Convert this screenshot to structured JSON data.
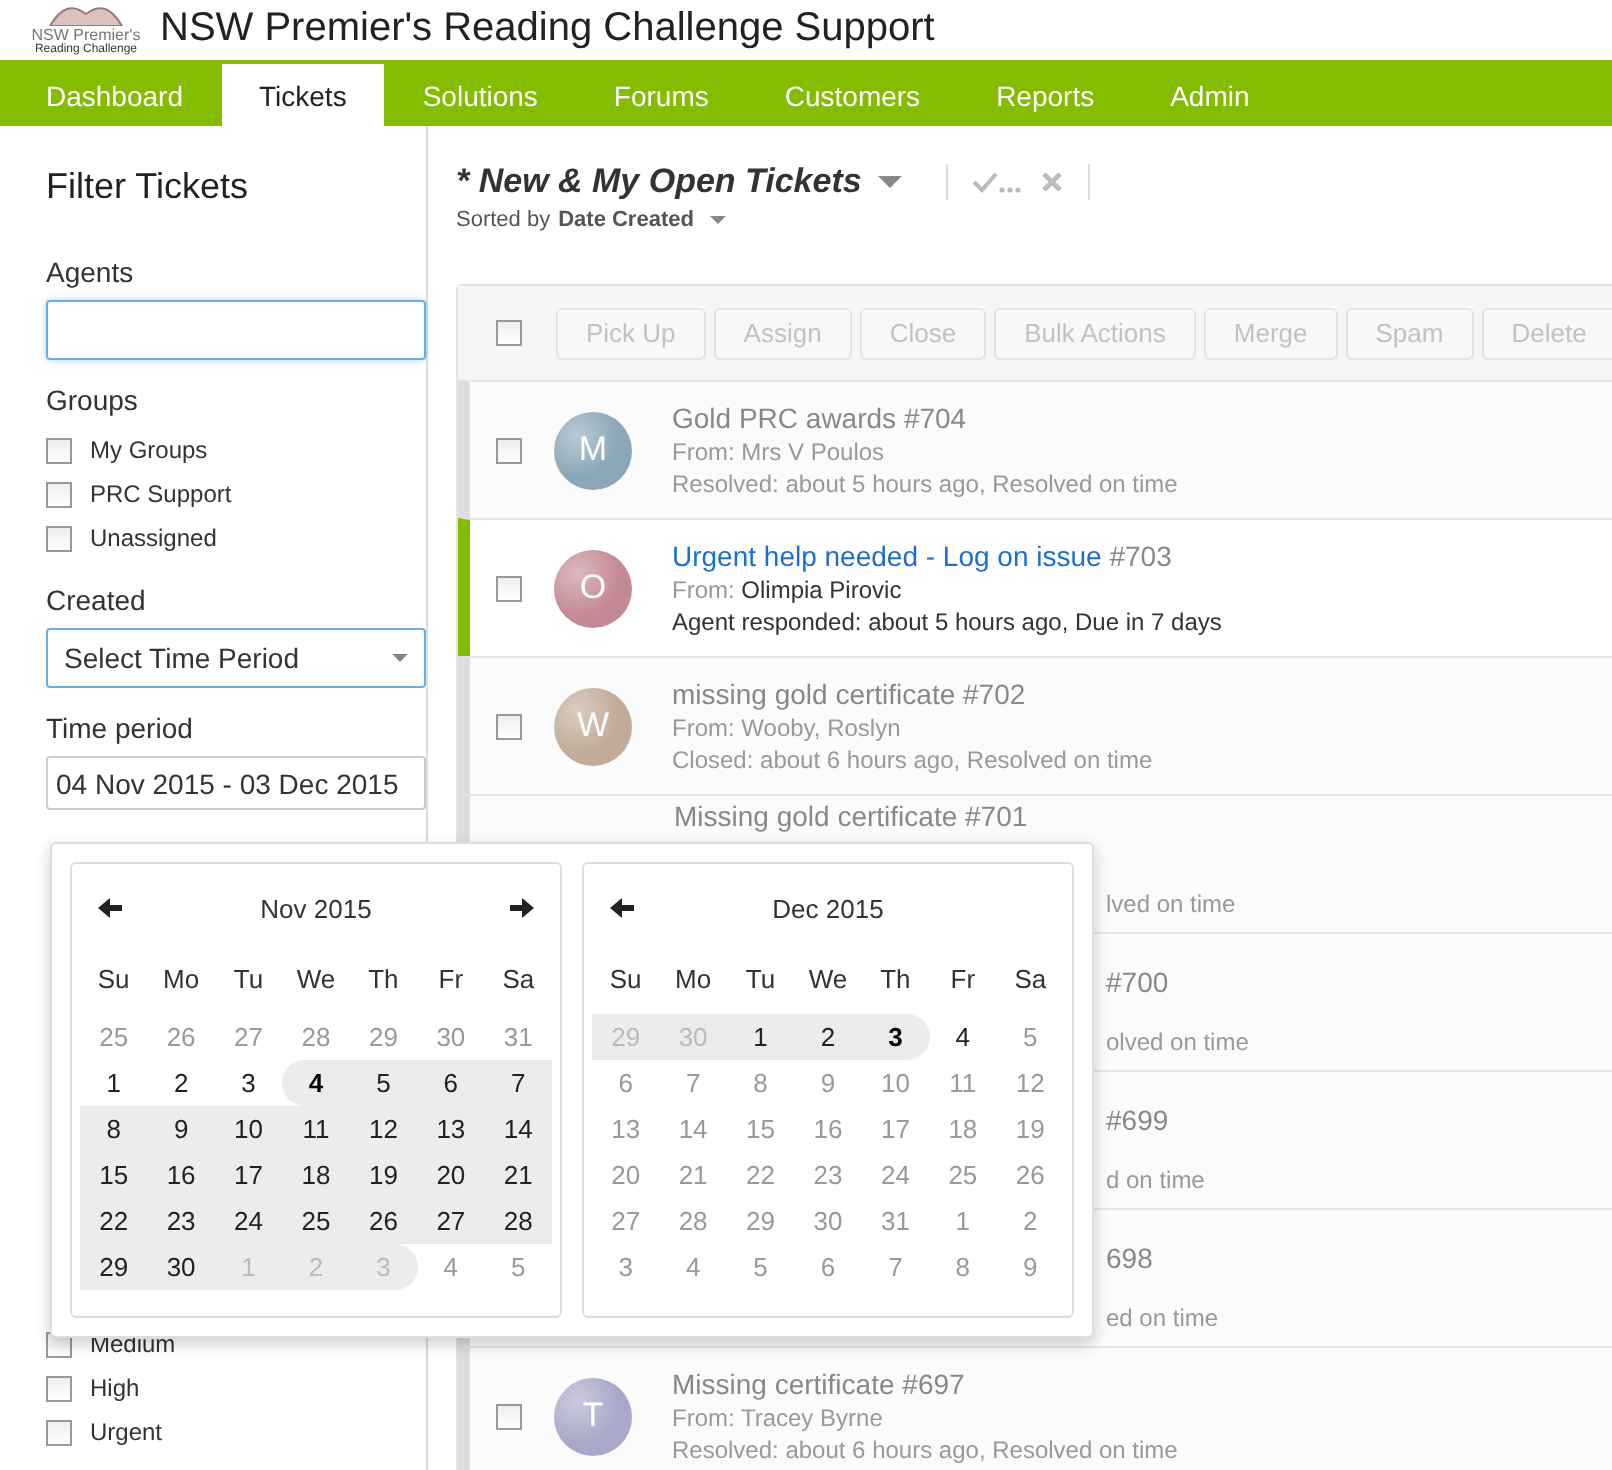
{
  "header": {
    "logo_text": "NSW Premier's",
    "logo_subtext": "Reading Challenge",
    "title": "NSW Premier's Reading Challenge Support"
  },
  "nav": [
    {
      "label": "Dashboard",
      "selected": false
    },
    {
      "label": "Tickets",
      "selected": true
    },
    {
      "label": "Solutions",
      "selected": false
    },
    {
      "label": "Forums",
      "selected": false
    },
    {
      "label": "Customers",
      "selected": false
    },
    {
      "label": "Reports",
      "selected": false
    },
    {
      "label": "Admin",
      "selected": false
    }
  ],
  "sidebar": {
    "title": "Filter Tickets",
    "agents_label": "Agents",
    "groups_label": "Groups",
    "groups": [
      {
        "label": "My Groups",
        "checked": false
      },
      {
        "label": "PRC Support",
        "checked": false
      },
      {
        "label": "Unassigned",
        "checked": false
      }
    ],
    "created_label": "Created",
    "created_value": "Select Time Period",
    "period_label": "Time period",
    "period_value": "04 Nov 2015 - 03 Dec 2015",
    "priorities": [
      {
        "label": "Medium",
        "checked": false
      },
      {
        "label": "High",
        "checked": false
      },
      {
        "label": "Urgent",
        "checked": false
      }
    ]
  },
  "view": {
    "title": "* New & My Open Tickets",
    "sorted_prefix": "Sorted by",
    "sorted_value": "Date Created"
  },
  "toolbar": {
    "checked": false,
    "buttons": [
      "Pick Up",
      "Assign",
      "Close",
      "Bulk Actions",
      "Merge",
      "Spam",
      "Delete"
    ]
  },
  "tickets": [
    {
      "kind": "full",
      "open": false,
      "avatar": "M",
      "color": "#8aa6b8",
      "title": "Gold PRC awards",
      "number": "#704",
      "from_label": "From:",
      "from": "Mrs V Poulos",
      "status": "Resolved: about 5 hours ago, Resolved on time"
    },
    {
      "kind": "full",
      "open": true,
      "avatar": "O",
      "color": "#c48a93",
      "title": "Urgent help needed - Log on issue",
      "number": "#703",
      "from_label": "From:",
      "from": "Olimpia Pirovic",
      "status": "Agent responded: about 5 hours ago, Due in 7 days"
    },
    {
      "kind": "full",
      "open": false,
      "avatar": "W",
      "color": "#c2ab98",
      "title": "missing gold certificate",
      "number": "#702",
      "from_label": "From:",
      "from": "Wooby, Roslyn",
      "status": "Closed: about 6 hours ago, Resolved on time"
    },
    {
      "kind": "covered",
      "title": "Missing gold certificate #701",
      "status": "lved on time"
    },
    {
      "kind": "covered",
      "title": "#700",
      "status": "olved on time"
    },
    {
      "kind": "covered",
      "title": "#699",
      "status": "d on time"
    },
    {
      "kind": "covered",
      "title": "698",
      "status": "ed on time"
    },
    {
      "kind": "full",
      "open": false,
      "avatar": "T",
      "color": "#a9a8c8",
      "title": "Missing certificate",
      "number": "#697",
      "from_label": "From:",
      "from": "Tracey Byrne",
      "status": "Resolved: about 6 hours ago, Resolved on time"
    }
  ],
  "calendars": [
    {
      "month": "Nov 2015",
      "prev": true,
      "next": true,
      "weekdays": [
        "Su",
        "Mo",
        "Tu",
        "We",
        "Th",
        "Fr",
        "Sa"
      ],
      "weeks": [
        [
          {
            "d": "25",
            "muted": true,
            "in_range": false,
            "endpoint": false
          },
          {
            "d": "26",
            "muted": true,
            "in_range": false,
            "endpoint": false
          },
          {
            "d": "27",
            "muted": true,
            "in_range": false,
            "endpoint": false
          },
          {
            "d": "28",
            "muted": true,
            "in_range": false,
            "endpoint": false
          },
          {
            "d": "29",
            "muted": true,
            "in_range": false,
            "endpoint": false
          },
          {
            "d": "30",
            "muted": true,
            "in_range": false,
            "endpoint": false
          },
          {
            "d": "31",
            "muted": true,
            "in_range": false,
            "endpoint": false
          }
        ],
        [
          {
            "d": "1",
            "muted": false,
            "in_range": false,
            "endpoint": false
          },
          {
            "d": "2",
            "muted": false,
            "in_range": false,
            "endpoint": false
          },
          {
            "d": "3",
            "muted": false,
            "in_range": false,
            "endpoint": false
          },
          {
            "d": "4",
            "muted": false,
            "in_range": true,
            "endpoint": true
          },
          {
            "d": "5",
            "muted": false,
            "in_range": true,
            "endpoint": false
          },
          {
            "d": "6",
            "muted": false,
            "in_range": true,
            "endpoint": false
          },
          {
            "d": "7",
            "muted": false,
            "in_range": true,
            "endpoint": false
          }
        ],
        [
          {
            "d": "8",
            "muted": false,
            "in_range": true,
            "endpoint": false
          },
          {
            "d": "9",
            "muted": false,
            "in_range": true,
            "endpoint": false
          },
          {
            "d": "10",
            "muted": false,
            "in_range": true,
            "endpoint": false
          },
          {
            "d": "11",
            "muted": false,
            "in_range": true,
            "endpoint": false
          },
          {
            "d": "12",
            "muted": false,
            "in_range": true,
            "endpoint": false
          },
          {
            "d": "13",
            "muted": false,
            "in_range": true,
            "endpoint": false
          },
          {
            "d": "14",
            "muted": false,
            "in_range": true,
            "endpoint": false
          }
        ],
        [
          {
            "d": "15",
            "muted": false,
            "in_range": true,
            "endpoint": false
          },
          {
            "d": "16",
            "muted": false,
            "in_range": true,
            "endpoint": false
          },
          {
            "d": "17",
            "muted": false,
            "in_range": true,
            "endpoint": false
          },
          {
            "d": "18",
            "muted": false,
            "in_range": true,
            "endpoint": false
          },
          {
            "d": "19",
            "muted": false,
            "in_range": true,
            "endpoint": false
          },
          {
            "d": "20",
            "muted": false,
            "in_range": true,
            "endpoint": false
          },
          {
            "d": "21",
            "muted": false,
            "in_range": true,
            "endpoint": false
          }
        ],
        [
          {
            "d": "22",
            "muted": false,
            "in_range": true,
            "endpoint": false
          },
          {
            "d": "23",
            "muted": false,
            "in_range": true,
            "endpoint": false
          },
          {
            "d": "24",
            "muted": false,
            "in_range": true,
            "endpoint": false
          },
          {
            "d": "25",
            "muted": false,
            "in_range": true,
            "endpoint": false
          },
          {
            "d": "26",
            "muted": false,
            "in_range": true,
            "endpoint": false
          },
          {
            "d": "27",
            "muted": false,
            "in_range": true,
            "endpoint": false
          },
          {
            "d": "28",
            "muted": false,
            "in_range": true,
            "endpoint": false
          }
        ],
        [
          {
            "d": "29",
            "muted": false,
            "in_range": true,
            "endpoint": false
          },
          {
            "d": "30",
            "muted": false,
            "in_range": true,
            "endpoint": false
          },
          {
            "d": "1",
            "muted": true,
            "in_range": true,
            "endpoint": false
          },
          {
            "d": "2",
            "muted": true,
            "in_range": true,
            "endpoint": false
          },
          {
            "d": "3",
            "muted": true,
            "in_range": true,
            "endpoint": false
          },
          {
            "d": "4",
            "muted": true,
            "in_range": false,
            "endpoint": false
          },
          {
            "d": "5",
            "muted": true,
            "in_range": false,
            "endpoint": false
          }
        ]
      ]
    },
    {
      "month": "Dec 2015",
      "prev": true,
      "next": false,
      "weekdays": [
        "Su",
        "Mo",
        "Tu",
        "We",
        "Th",
        "Fr",
        "Sa"
      ],
      "weeks": [
        [
          {
            "d": "29",
            "muted": true,
            "in_range": true,
            "endpoint": false
          },
          {
            "d": "30",
            "muted": true,
            "in_range": true,
            "endpoint": false
          },
          {
            "d": "1",
            "muted": false,
            "in_range": true,
            "endpoint": false
          },
          {
            "d": "2",
            "muted": false,
            "in_range": true,
            "endpoint": false
          },
          {
            "d": "3",
            "muted": false,
            "in_range": true,
            "endpoint": true
          },
          {
            "d": "4",
            "muted": false,
            "in_range": false,
            "endpoint": false
          },
          {
            "d": "5",
            "muted": true,
            "in_range": false,
            "endpoint": false
          }
        ],
        [
          {
            "d": "6",
            "muted": true,
            "in_range": false,
            "endpoint": false
          },
          {
            "d": "7",
            "muted": true,
            "in_range": false,
            "endpoint": false
          },
          {
            "d": "8",
            "muted": true,
            "in_range": false,
            "endpoint": false
          },
          {
            "d": "9",
            "muted": true,
            "in_range": false,
            "endpoint": false
          },
          {
            "d": "10",
            "muted": true,
            "in_range": false,
            "endpoint": false
          },
          {
            "d": "11",
            "muted": true,
            "in_range": false,
            "endpoint": false
          },
          {
            "d": "12",
            "muted": true,
            "in_range": false,
            "endpoint": false
          }
        ],
        [
          {
            "d": "13",
            "muted": true,
            "in_range": false,
            "endpoint": false
          },
          {
            "d": "14",
            "muted": true,
            "in_range": false,
            "endpoint": false
          },
          {
            "d": "15",
            "muted": true,
            "in_range": false,
            "endpoint": false
          },
          {
            "d": "16",
            "muted": true,
            "in_range": false,
            "endpoint": false
          },
          {
            "d": "17",
            "muted": true,
            "in_range": false,
            "endpoint": false
          },
          {
            "d": "18",
            "muted": true,
            "in_range": false,
            "endpoint": false
          },
          {
            "d": "19",
            "muted": true,
            "in_range": false,
            "endpoint": false
          }
        ],
        [
          {
            "d": "20",
            "muted": true,
            "in_range": false,
            "endpoint": false
          },
          {
            "d": "21",
            "muted": true,
            "in_range": false,
            "endpoint": false
          },
          {
            "d": "22",
            "muted": true,
            "in_range": false,
            "endpoint": false
          },
          {
            "d": "23",
            "muted": true,
            "in_range": false,
            "endpoint": false
          },
          {
            "d": "24",
            "muted": true,
            "in_range": false,
            "endpoint": false
          },
          {
            "d": "25",
            "muted": true,
            "in_range": false,
            "endpoint": false
          },
          {
            "d": "26",
            "muted": true,
            "in_range": false,
            "endpoint": false
          }
        ],
        [
          {
            "d": "27",
            "muted": true,
            "in_range": false,
            "endpoint": false
          },
          {
            "d": "28",
            "muted": true,
            "in_range": false,
            "endpoint": false
          },
          {
            "d": "29",
            "muted": true,
            "in_range": false,
            "endpoint": false
          },
          {
            "d": "30",
            "muted": true,
            "in_range": false,
            "endpoint": false
          },
          {
            "d": "31",
            "muted": true,
            "in_range": false,
            "endpoint": false
          },
          {
            "d": "1",
            "muted": true,
            "in_range": false,
            "endpoint": false
          },
          {
            "d": "2",
            "muted": true,
            "in_range": false,
            "endpoint": false
          }
        ],
        [
          {
            "d": "3",
            "muted": true,
            "in_range": false,
            "endpoint": false
          },
          {
            "d": "4",
            "muted": true,
            "in_range": false,
            "endpoint": false
          },
          {
            "d": "5",
            "muted": true,
            "in_range": false,
            "endpoint": false
          },
          {
            "d": "6",
            "muted": true,
            "in_range": false,
            "endpoint": false
          },
          {
            "d": "7",
            "muted": true,
            "in_range": false,
            "endpoint": false
          },
          {
            "d": "8",
            "muted": true,
            "in_range": false,
            "endpoint": false
          },
          {
            "d": "9",
            "muted": true,
            "in_range": false,
            "endpoint": false
          }
        ]
      ]
    }
  ]
}
